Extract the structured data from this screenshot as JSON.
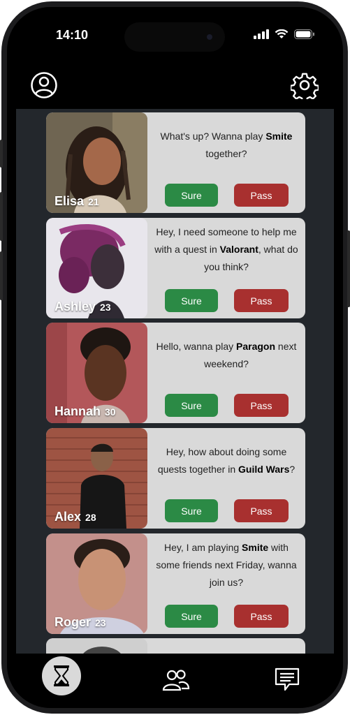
{
  "status": {
    "time": "14:10"
  },
  "cards": [
    {
      "name": "Elisa",
      "age": "21",
      "pre": "What's up? Wanna play ",
      "game": "Smite",
      "post": " together?",
      "sure": "Sure",
      "pass": "Pass"
    },
    {
      "name": "Ashley",
      "age": "23",
      "pre": "Hey, I need someone to help me with a quest in ",
      "game": "Valorant",
      "post": ", what do you think?",
      "sure": "Sure",
      "pass": "Pass"
    },
    {
      "name": "Hannah",
      "age": "30",
      "pre": "Hello, wanna play ",
      "game": "Paragon",
      "post": " next weekend?",
      "sure": "Sure",
      "pass": "Pass"
    },
    {
      "name": "Alex",
      "age": "28",
      "pre": "Hey, how about doing some quests together in ",
      "game": "Guild Wars",
      "post": "?",
      "sure": "Sure",
      "pass": "Pass"
    },
    {
      "name": "Roger",
      "age": "23",
      "pre": "Hey, I am playing ",
      "game": "Smite",
      "post": " with some friends next Friday, wanna join us?",
      "sure": "Sure",
      "pass": "Pass"
    }
  ],
  "colors": {
    "sure": "#2b8a45",
    "pass": "#a8302f",
    "card": "#d9d9d9",
    "feed": "#23272c"
  },
  "icons": {
    "profile": "user-circle-icon",
    "settings": "gear-icon",
    "nav": [
      "hourglass-icon",
      "friends-icon",
      "chat-icon"
    ]
  }
}
